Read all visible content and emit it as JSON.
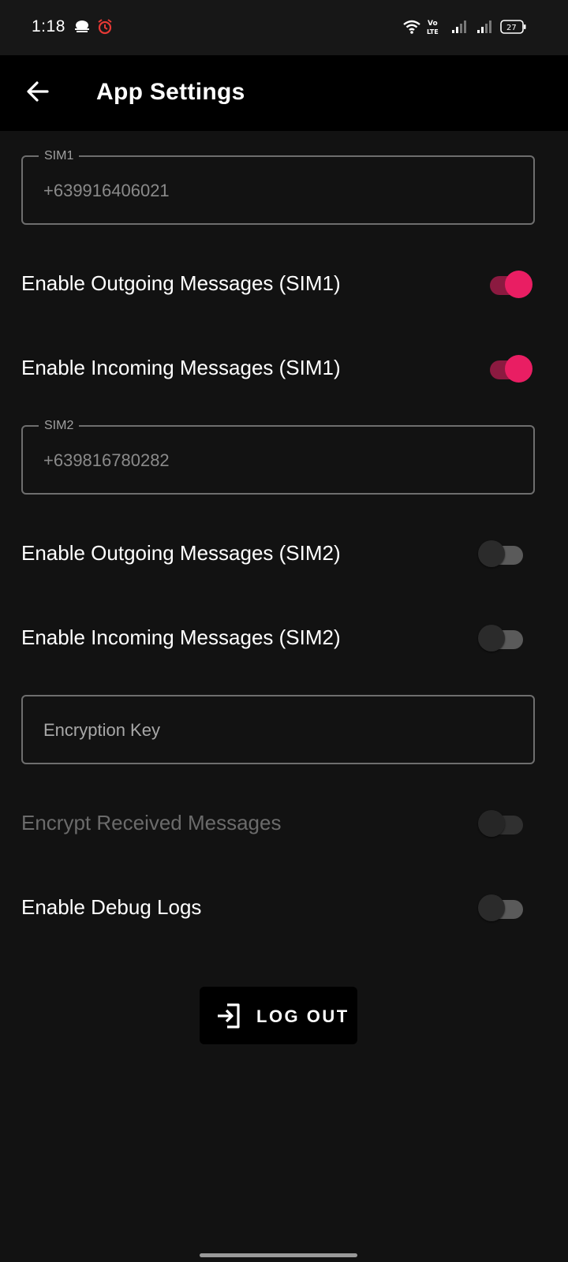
{
  "status_bar": {
    "time": "1:18",
    "battery": "27",
    "icons": [
      "cloud-icon",
      "alarm-icon",
      "wifi-icon",
      "volte-icon",
      "signal-icon",
      "signal-icon",
      "battery-icon"
    ]
  },
  "app_bar": {
    "title": "App Settings",
    "back_icon": "arrow-left-icon"
  },
  "sim1": {
    "label": "SIM1",
    "value": "+639916406021",
    "outgoing_label": "Enable Outgoing Messages (SIM1)",
    "outgoing_enabled": true,
    "incoming_label": "Enable Incoming Messages (SIM1)",
    "incoming_enabled": true
  },
  "sim2": {
    "label": "SIM2",
    "value": "+639816780282",
    "outgoing_label": "Enable Outgoing Messages (SIM2)",
    "outgoing_enabled": false,
    "incoming_label": "Enable Incoming Messages (SIM2)",
    "incoming_enabled": false
  },
  "encryption": {
    "placeholder": "Encryption Key",
    "encrypt_label": "Encrypt Received Messages",
    "encrypt_enabled": false,
    "encrypt_disabled": true
  },
  "debug": {
    "label": "Enable Debug Logs",
    "enabled": false
  },
  "logout": {
    "label": "LOG OUT",
    "icon": "login-arrow-icon"
  },
  "colors": {
    "accent": "#e91e63",
    "accent_track": "#8b1a40",
    "background": "#121212",
    "app_bar": "#000000"
  }
}
